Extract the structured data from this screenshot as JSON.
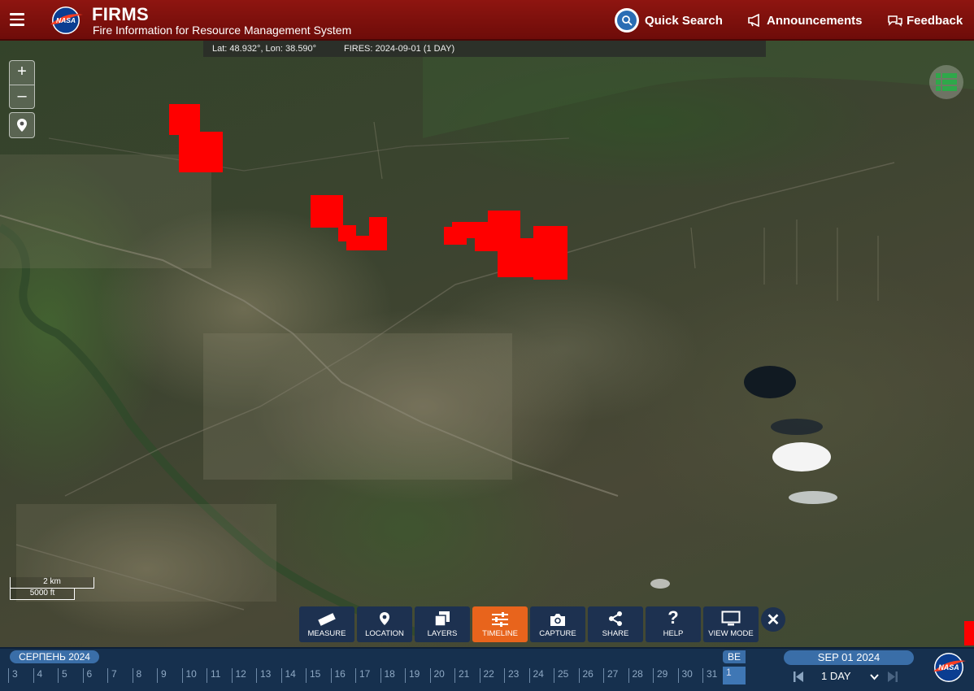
{
  "header": {
    "title": "FIRMS",
    "subtitle": "Fire Information for Resource Management System",
    "logo_text": "NASA",
    "quick_search": "Quick Search",
    "announcements": "Announcements",
    "feedback": "Feedback"
  },
  "status_bar": {
    "coords": "Lat: 48.932°, Lon: 38.590°",
    "fires": "FIRES: 2024-09-01 (1 DAY)"
  },
  "map_controls": {
    "zoom_in": "+",
    "zoom_out": "–"
  },
  "scale": {
    "km": "2 km",
    "ft": "5000 ft"
  },
  "toolbar": [
    {
      "label": "MEASURE",
      "icon": "ruler-icon"
    },
    {
      "label": "LOCATION",
      "icon": "map-pin-icon"
    },
    {
      "label": "LAYERS",
      "icon": "layers-icon"
    },
    {
      "label": "TIMELINE",
      "icon": "sliders-icon",
      "active": true
    },
    {
      "label": "CAPTURE",
      "icon": "camera-icon"
    },
    {
      "label": "SHARE",
      "icon": "share-icon"
    },
    {
      "label": "HELP",
      "icon": "question-icon"
    },
    {
      "label": "VIEW MODE",
      "icon": "monitor-icon"
    }
  ],
  "timeline": {
    "month": "СЕРПЕНЬ 2024",
    "days": [
      "3",
      "4",
      "5",
      "6",
      "7",
      "8",
      "9",
      "10",
      "11",
      "12",
      "13",
      "14",
      "15",
      "16",
      "17",
      "18",
      "19",
      "20",
      "21",
      "22",
      "23",
      "24",
      "25",
      "26",
      "27",
      "28",
      "29",
      "30",
      "31"
    ],
    "next_month_abbr": "ВЕ",
    "current_day": "1",
    "selected_date": "SEP 01 2024",
    "range": "1 DAY"
  },
  "colors": {
    "header": "#8e1510",
    "fire": "#ff0000",
    "toolbar": "#1d3150",
    "active_tool": "#e8641c",
    "timeline": "#16304e"
  }
}
